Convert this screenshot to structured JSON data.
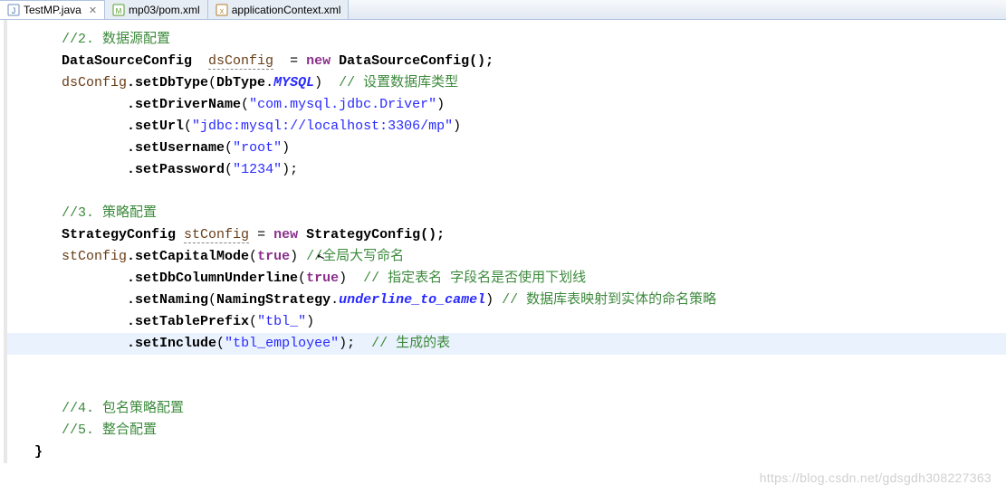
{
  "tabs": [
    {
      "label": "TestMP.java",
      "active": true,
      "closable": true,
      "icon": "java-file-icon"
    },
    {
      "label": "mp03/pom.xml",
      "active": false,
      "closable": false,
      "icon": "maven-file-icon"
    },
    {
      "label": "applicationContext.xml",
      "active": false,
      "closable": false,
      "icon": "xml-file-icon"
    }
  ],
  "code": {
    "c1": "//2. 数据源配置",
    "t_DataSourceConfig": "DataSourceConfig",
    "v_dsConfig": "dsConfig",
    "op_eq": "=",
    "kw_new": "new",
    "ctor_ds": "DataSourceConfig();",
    "m_setDbType": ".setDbType",
    "t_DbType": "DbType",
    "s_MYSQL": "MYSQL",
    "c_dbtype": "// 设置数据库类型",
    "m_setDriverName": ".setDriverName",
    "s_driver": "\"com.mysql.jdbc.Driver\"",
    "m_setUrl": ".setUrl",
    "s_url": "\"jdbc:mysql://localhost:3306/mp\"",
    "m_setUsername": ".setUsername",
    "s_user": "\"root\"",
    "m_setPassword": ".setPassword",
    "s_pass": "\"1234\"",
    "c3": "//3. 策略配置",
    "t_StrategyConfig": "StrategyConfig",
    "v_stConfig": "stConfig",
    "ctor_st": "StrategyConfig();",
    "m_setCapitalMode": ".setCapitalMode",
    "kw_true": "true",
    "c_cap": "//全局大写命名",
    "m_setDbColumnUnderline": ".setDbColumnUnderline",
    "c_underline": "// 指定表名 字段名是否使用下划线",
    "m_setNaming": ".setNaming",
    "t_NamingStrategy": "NamingStrategy",
    "s_u2c": "underline_to_camel",
    "c_naming": "// 数据库表映射到实体的命名策略",
    "m_setTablePrefix": ".setTablePrefix",
    "s_prefix": "\"tbl_\"",
    "m_setInclude": ".setInclude",
    "s_include": "\"tbl_employee\"",
    "c_include": "// 生成的表",
    "c4": "//4. 包名策略配置",
    "c5": "//5. 整合配置",
    "brace": "}"
  },
  "watermark": "https://blog.csdn.net/gdsgdh308227363"
}
